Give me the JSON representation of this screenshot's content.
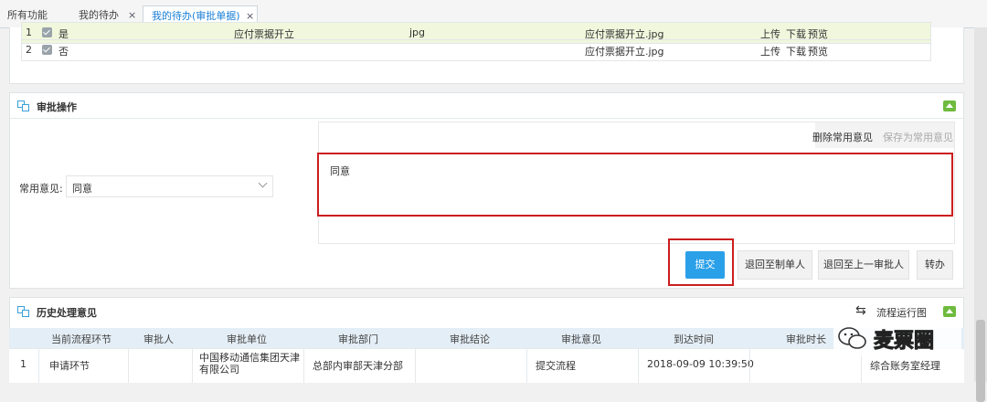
{
  "tabs": [
    {
      "label": "所有功能"
    },
    {
      "label": "我的待办",
      "close": "×"
    },
    {
      "label": "我的待办(审批单据)",
      "close": "×"
    }
  ],
  "attachments": {
    "rows": [
      {
        "index": "1",
        "required": "是",
        "desc": "应付票据开立",
        "ext": "jpg",
        "file": "应付票据开立.jpg",
        "actions": [
          "上传",
          "下载",
          "预览"
        ]
      },
      {
        "index": "2",
        "required": "否",
        "desc": "",
        "ext": "",
        "file": "应付票据开立.jpg",
        "actions": [
          "上传",
          "下载",
          "预览"
        ]
      }
    ]
  },
  "approval": {
    "title": "审批操作",
    "common_opinion_label": "常用意见:",
    "common_opinion_value": "同意",
    "delete_common": "删除常用意见",
    "save_common": "保存为常用意见",
    "opinion_text": "同意",
    "buttons": {
      "submit": "提交",
      "return_maker": "退回至制单人",
      "return_prev": "退回至上一审批人",
      "transfer": "转办"
    }
  },
  "history": {
    "title": "历史处理意见",
    "flow_chart": "流程运行图",
    "columns": [
      "当前流程环节",
      "审批人",
      "审批单位",
      "审批部门",
      "审批结论",
      "审批意见",
      "到达时间",
      "审批时长"
    ],
    "rows": [
      {
        "index": "1",
        "step": "申请环节",
        "approver": "",
        "unit": "中国移动通信集团天津有限公司",
        "dept": "总部内审部天津分部",
        "conclusion": "",
        "opinion": "提交流程",
        "arrival": "2018-09-09 10:39:50",
        "duration": "",
        "role": "综合账务室经理"
      }
    ]
  },
  "watermark": "麦票圈",
  "colors": {
    "accent": "#2aa0e8",
    "highlight": "#cc1e1e",
    "tab_active": "#1a7fd6",
    "header_bg": "#e4eef6"
  }
}
